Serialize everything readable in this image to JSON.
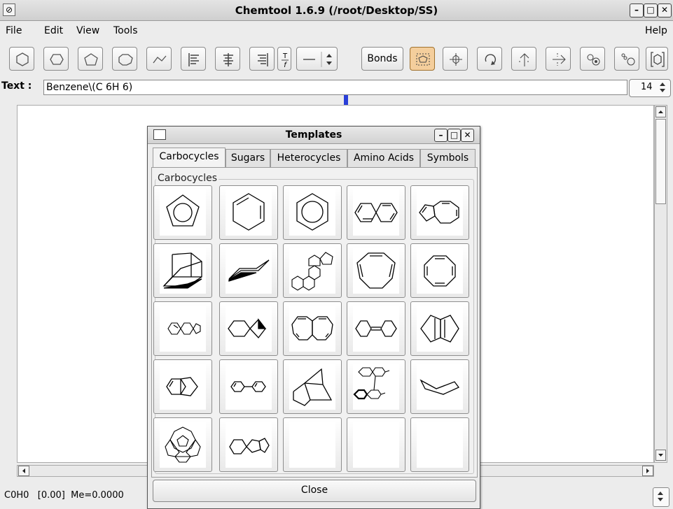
{
  "window": {
    "title": "Chemtool 1.6.9 (/root/Desktop/SS)"
  },
  "menu": {
    "file": "File",
    "edit": "Edit",
    "view": "View",
    "tools": "Tools",
    "help": "Help"
  },
  "toolbar": {
    "bonds_label": "Bonds",
    "text_align_label": "T"
  },
  "text_field": {
    "label": "Text :",
    "value": "Benzene\\(C 6H 6)"
  },
  "font_size": {
    "value": "14"
  },
  "status": {
    "text": "C0H0   [0.00]  Me=0.0000"
  },
  "templates_dialog": {
    "title": "Templates",
    "tabs": [
      "Carbocycles",
      "Sugars",
      "Heterocycles",
      "Amino Acids",
      "Symbols"
    ],
    "active_tab": "Carbocycles",
    "group_label": "Carbocycles",
    "close_label": "Close",
    "templates": [
      "cyclopentadienyl",
      "cyclohexane",
      "benzene",
      "naphthalene",
      "azulene",
      "adamantane",
      "chair-cyclohexane",
      "steroid-skeleton",
      "cycloheptatriene",
      "cyclooctatetraene",
      "small-fused-rings",
      "spiro-compound",
      "heptalene",
      "bicycloheptatriene",
      "bridged-bicycle",
      "indane",
      "biphenyl",
      "norbornane",
      "binaphthyl",
      "boat-cyclohexane",
      "polycyclic-cage",
      "pentalene-dimer",
      "empty",
      "empty",
      "empty"
    ]
  }
}
